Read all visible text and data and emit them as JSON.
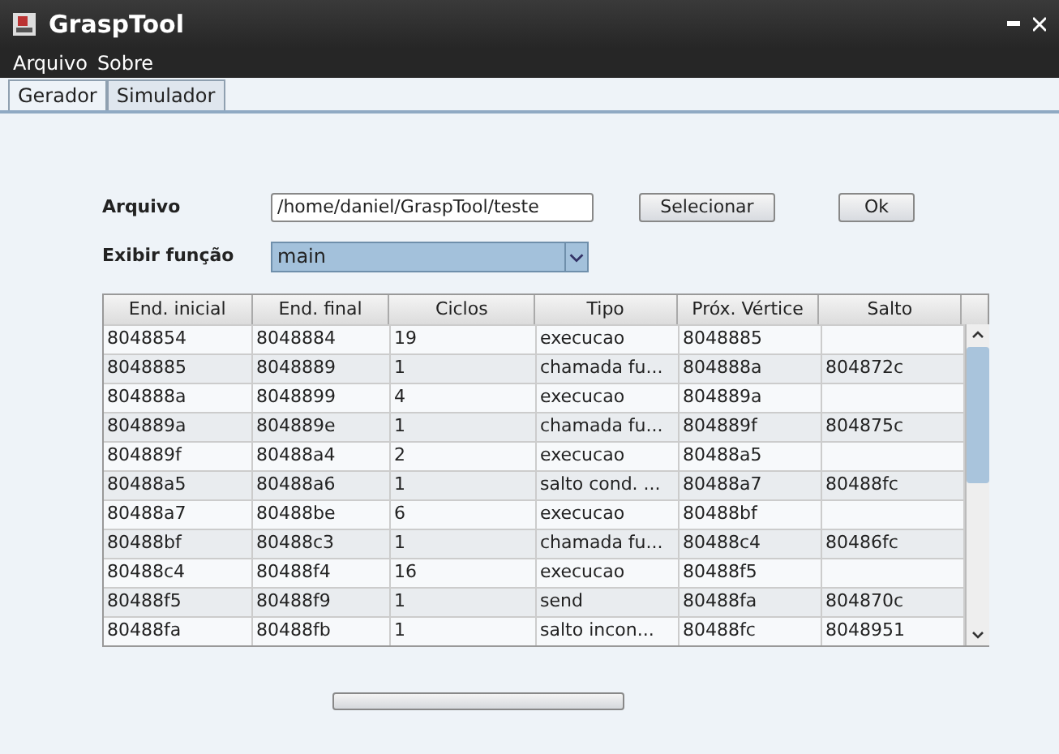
{
  "window": {
    "title": "GraspTool"
  },
  "menu": [
    "Arquivo",
    "Sobre"
  ],
  "tabs": [
    {
      "label": "Gerador",
      "selected": true
    },
    {
      "label": "Simulador",
      "selected": false
    }
  ],
  "arquivo": {
    "label": "Arquivo",
    "value": "/home/daniel/GraspTool/teste",
    "buttons": [
      "Selecionar",
      "Ok"
    ]
  },
  "funcao": {
    "label": "Exibir função",
    "value": "main"
  },
  "table": {
    "columns": [
      "End. inicial",
      "End. final",
      "Ciclos",
      "Tipo",
      "Próx. Vértice",
      "Salto"
    ],
    "rows": [
      [
        "8048854",
        "8048884",
        "19",
        "execucao",
        "8048885",
        ""
      ],
      [
        "8048885",
        "8048889",
        "1",
        "chamada fu...",
        "804888a",
        "804872c"
      ],
      [
        "804888a",
        "8048899",
        "4",
        "execucao",
        "804889a",
        ""
      ],
      [
        "804889a",
        "804889e",
        "1",
        "chamada fu...",
        "804889f",
        "804875c"
      ],
      [
        "804889f",
        "80488a4",
        "2",
        "execucao",
        "80488a5",
        ""
      ],
      [
        "80488a5",
        "80488a6",
        "1",
        "salto cond. ...",
        "80488a7",
        "80488fc"
      ],
      [
        "80488a7",
        "80488be",
        "6",
        "execucao",
        "80488bf",
        ""
      ],
      [
        "80488bf",
        "80488c3",
        "1",
        "chamada fu...",
        "80488c4",
        "80486fc"
      ],
      [
        "80488c4",
        "80488f4",
        "16",
        "execucao",
        "80488f5",
        ""
      ],
      [
        "80488f5",
        "80488f9",
        "1",
        "send",
        "80488fa",
        "804870c"
      ],
      [
        "80488fa",
        "80488fb",
        "1",
        "salto incon...",
        "80488fc",
        "8048951"
      ]
    ]
  },
  "progress": {
    "level": 0
  }
}
